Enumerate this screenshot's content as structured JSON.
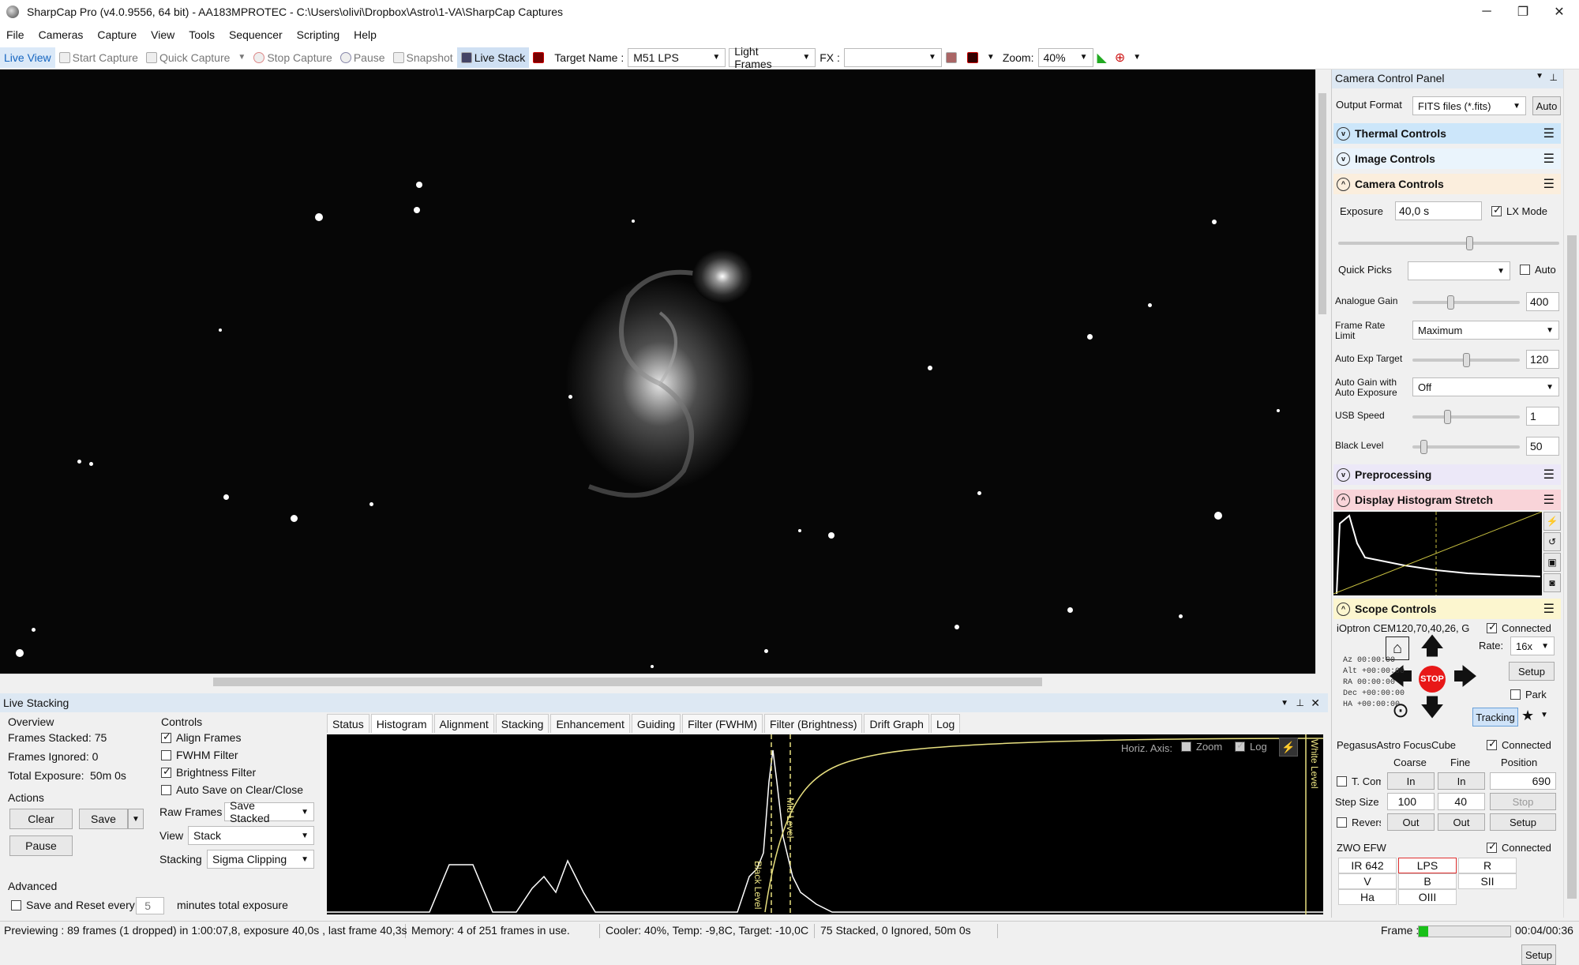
{
  "window": {
    "title": "SharpCap Pro (v4.0.9556, 64 bit) - AA183MPROTEC - C:\\Users\\olivi\\Dropbox\\Astro\\1-VA\\SharpCap Captures",
    "minimize": "─",
    "maximize": "❐",
    "close": "✕"
  },
  "menu": [
    "File",
    "Cameras",
    "Capture",
    "View",
    "Tools",
    "Sequencer",
    "Scripting",
    "Help"
  ],
  "toolbar": {
    "live_view": "Live View",
    "start_capture": "Start Capture",
    "quick_capture": "Quick Capture",
    "stop_capture": "Stop Capture",
    "pause": "Pause",
    "snapshot": "Snapshot",
    "live_stack": "Live Stack",
    "target_name_label": "Target Name :",
    "target_name_value": "M51 LPS",
    "frame_type": "Light Frames",
    "fx_label": "FX :",
    "fx_value": "",
    "zoom_label": "Zoom:",
    "zoom_value": "40%"
  },
  "live_stacking": {
    "header": "Live Stacking",
    "overview_label": "Overview",
    "frames_stacked": "Frames Stacked: 75",
    "frames_ignored": "Frames Ignored: 0",
    "total_exposure_label": "Total Exposure:",
    "total_exposure_value": "50m 0s",
    "actions_label": "Actions",
    "clear": "Clear",
    "save": "Save",
    "pause": "Pause",
    "advanced_label": "Advanced",
    "save_reset_label": "Save and Reset every",
    "save_reset_value": "5",
    "save_reset_suffix": "minutes total exposure",
    "controls_label": "Controls",
    "align_frames": "Align Frames",
    "fwhm_filter": "FWHM Filter",
    "brightness_filter": "Brightness Filter",
    "auto_save": "Auto Save on Clear/Close",
    "raw_frames_label": "Raw Frames",
    "raw_frames_value": "Save Stacked",
    "view_label": "View",
    "view_value": "Stack",
    "stacking_label": "Stacking",
    "stacking_value": "Sigma Clipping",
    "tabs": [
      "Status",
      "Histogram",
      "Alignment",
      "Stacking",
      "Enhancement",
      "Guiding",
      "Filter (FWHM)",
      "Filter (Brightness)",
      "Drift Graph",
      "Log"
    ],
    "horiz_axis": "Horiz. Axis:",
    "zoom": "Zoom",
    "log": "Log",
    "black_level": "Black Level",
    "mid_level": "Mid Level",
    "white_level": "White Level"
  },
  "status": {
    "previewing": "Previewing : 89 frames (1 dropped) in 1:00:07,8, exposure 40,0s , last frame 40,3s",
    "memory": "Memory: 4 of 251 frames in use.",
    "cooler": "Cooler: 40%, Temp: -9,8C, Target: -10,0C",
    "stacked": "75 Stacked, 0 Ignored, 50m 0s",
    "frame_label": "Frame :",
    "frame_progress": 0.1,
    "time": "00:04/00:36"
  },
  "camera_panel": {
    "header": "Camera Control Panel",
    "output_format_label": "Output Format",
    "output_format_value": "FITS files (*.fits)",
    "auto_btn": "Auto",
    "thermal": "Thermal Controls",
    "image": "Image Controls",
    "camera": "Camera Controls",
    "exposure_label": "Exposure",
    "exposure_value": "40,0 s",
    "lx_mode": "LX Mode",
    "quick_picks": "Quick Picks",
    "quick_picks_auto": "Auto",
    "analogue_gain_label": "Analogue Gain",
    "analogue_gain_value": "400",
    "frame_rate_label": "Frame Rate Limit",
    "frame_rate_value": "Maximum",
    "auto_exp_label": "Auto Exp Target",
    "auto_exp_value": "120",
    "auto_gain_label": "Auto Gain with Auto Exposure",
    "auto_gain_value": "Off",
    "usb_speed_label": "USB Speed",
    "usb_speed_value": "1",
    "black_level_label": "Black Level",
    "black_level_value": "50",
    "preprocessing": "Preprocessing",
    "histo_stretch": "Display Histogram Stretch",
    "scope": "Scope Controls",
    "mount_name": "iOptron CEM120,70,40,26, G",
    "connected": "Connected",
    "rate_label": "Rate:",
    "rate_value": "16x",
    "setup": "Setup",
    "park": "Park",
    "tracking": "Tracking",
    "stop": "STOP",
    "coords": [
      "Az  00:00:00",
      "Alt +00:00:00",
      "RA  00:00:00",
      "Dec +00:00:00",
      "HA  +00:00:00"
    ],
    "focuser_name": "PegasusAstro FocusCube",
    "coarse": "Coarse",
    "fine": "Fine",
    "position": "Position",
    "t_comp": "T. Com",
    "in": "In",
    "out": "Out",
    "position_value": "690",
    "step_size_label": "Step Size",
    "step_coarse": "100",
    "step_fine": "40",
    "stop_btn": "Stop",
    "reverse": "Revers",
    "efw_name": "ZWO EFW",
    "filters": [
      "IR 642",
      "LPS",
      "R",
      "V",
      "B",
      "SII",
      "Ha",
      "OIII"
    ]
  }
}
